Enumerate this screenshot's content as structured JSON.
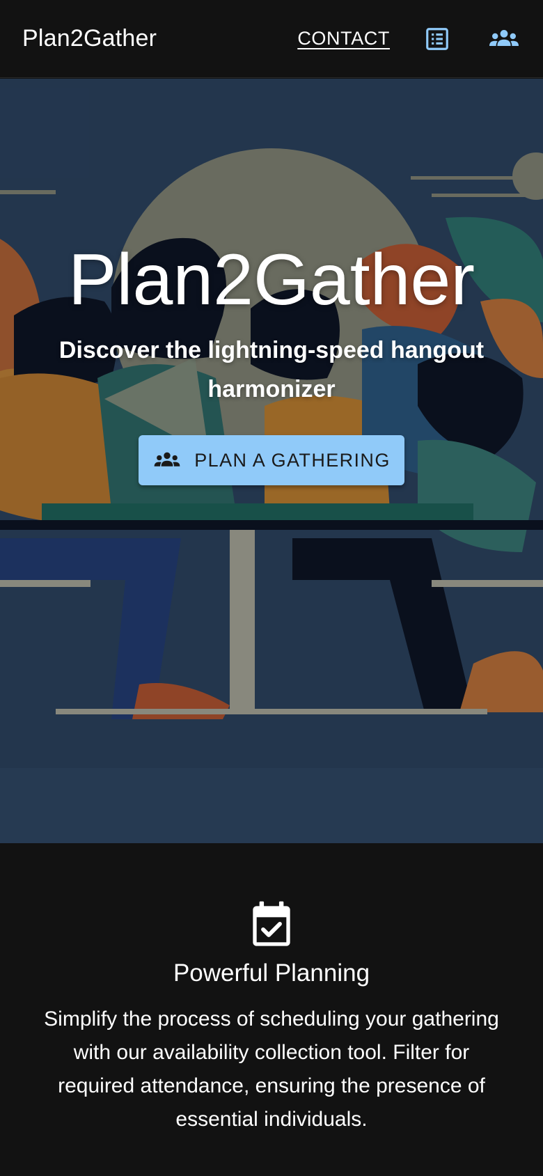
{
  "header": {
    "brand": "Plan2Gather",
    "contact_label": "CONTACT",
    "list_icon": "list-alt-icon",
    "groups_icon": "groups-icon",
    "accent": "#90caf9"
  },
  "hero": {
    "title": "Plan2Gather",
    "subtitle": "Discover the lightning-speed hangout harmonizer",
    "cta_label": "PLAN A GATHERING",
    "cta_icon": "groups-icon",
    "cta_color": "#90caf9"
  },
  "features": [
    {
      "icon": "event-available-icon",
      "title": "Powerful Planning",
      "description": "Simplify the process of scheduling your gathering with our availability collection tool. Filter for required attendance, ensuring the presence of essential individuals."
    }
  ]
}
